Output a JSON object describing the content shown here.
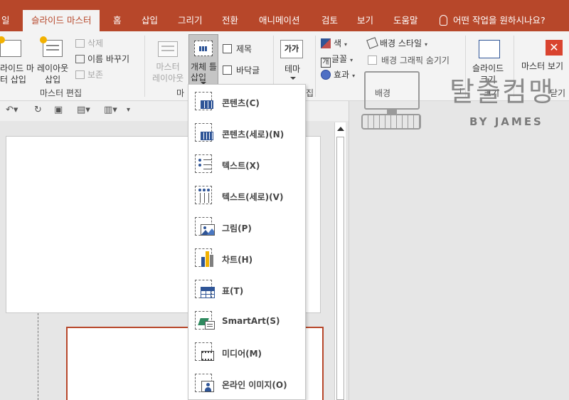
{
  "tabs": [
    "일",
    "슬라이드 마스터",
    "홈",
    "삽입",
    "그리기",
    "전환",
    "애니메이션",
    "검토",
    "보기",
    "도움말"
  ],
  "tell_me": "어떤 작업을 원하시나요?",
  "ribbon": {
    "insert_slide_master": "라이드 마\n터 삽입",
    "insert_layout": "레이아웃\n삽입",
    "delete": "삭제",
    "rename": "이름 바꾸기",
    "preserve": "보존",
    "group_master_edit": "마스터 편집",
    "master_layout": "마스터\n레이아웃",
    "group_master_layout_short": "마",
    "insert_placeholder": "개체 틀\n삽입",
    "title_check": "제목",
    "footer_check": "바닥글",
    "theme_icon_text": "가가",
    "theme": "테마",
    "group_edit_theme_short": "집",
    "colors": "색",
    "fonts": "글꼴",
    "effects": "효과",
    "background_styles": "배경 스타일",
    "hide_background_graphics": "배경 그래픽 숨기기",
    "group_background": "배경",
    "slide_size": "슬라이드\n크기",
    "group_size": "크기",
    "close_master_view": "마스터 보기",
    "group_close": "닫기"
  },
  "watermark": {
    "title": "탈출컴맹",
    "subtitle": "BY JAMES"
  },
  "menu": {
    "items": [
      {
        "label": "콘텐츠(C)",
        "icon": "content-placeholder-icon"
      },
      {
        "label": "콘텐츠(세로)(N)",
        "icon": "content-vertical-placeholder-icon"
      },
      {
        "label": "텍스트(X)",
        "icon": "text-placeholder-icon"
      },
      {
        "label": "텍스트(세로)(V)",
        "icon": "text-vertical-placeholder-icon"
      },
      {
        "label": "그림(P)",
        "icon": "picture-placeholder-icon"
      },
      {
        "label": "차트(H)",
        "icon": "chart-placeholder-icon"
      },
      {
        "label": "표(T)",
        "icon": "table-placeholder-icon"
      },
      {
        "label": "SmartArt(S)",
        "icon": "smartart-placeholder-icon"
      },
      {
        "label": "미디어(M)",
        "icon": "media-placeholder-icon"
      },
      {
        "label": "온라인 이미지(O)",
        "icon": "online-image-placeholder-icon"
      }
    ]
  }
}
